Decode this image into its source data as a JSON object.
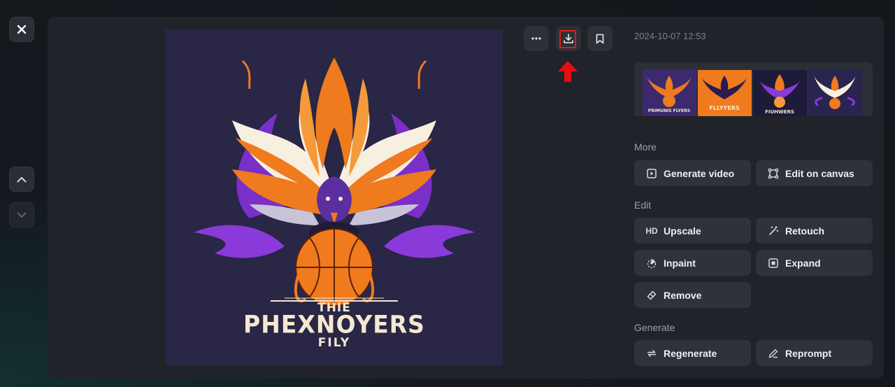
{
  "window": {
    "close_icon": "close-icon",
    "nav_up_icon": "chevron-up-icon",
    "nav_down_icon": "chevron-down-icon"
  },
  "image": {
    "text_line1": "THIE",
    "text_line2": "PHEXNOYERS",
    "text_line3": "FILY",
    "colors": {
      "background": "#292646",
      "flame": "#f07a1e",
      "purple": "#8a3ad8",
      "cream": "#f5e8d0"
    }
  },
  "toolbar": {
    "more_icon": "more-icon",
    "download_icon": "download-icon",
    "bookmark_icon": "bookmark-icon",
    "highlight_color": "#e01b1b"
  },
  "details": {
    "timestamp": "2024-10-07 12:53",
    "thumbnails": [
      {
        "caption": "PRIMUNIS FLYERS",
        "bg": "#3d2a6e"
      },
      {
        "caption": "FLLYYERS",
        "bg": "#f07a1e"
      },
      {
        "caption": "FIUHWERS",
        "bg": "#1e1a3a"
      },
      {
        "caption": "",
        "bg": "#2a2450"
      }
    ]
  },
  "sections": {
    "more": {
      "label": "More",
      "buttons": [
        {
          "label": "Generate video",
          "icon": "video-icon"
        },
        {
          "label": "Edit on canvas",
          "icon": "canvas-icon"
        }
      ]
    },
    "edit": {
      "label": "Edit",
      "buttons": [
        {
          "label": "Upscale",
          "icon": "HD"
        },
        {
          "label": "Retouch",
          "icon": "magic-wand-icon"
        },
        {
          "label": "Inpaint",
          "icon": "inpaint-icon"
        },
        {
          "label": "Expand",
          "icon": "expand-icon"
        },
        {
          "label": "Remove",
          "icon": "eraser-icon"
        }
      ]
    },
    "generate": {
      "label": "Generate",
      "buttons": [
        {
          "label": "Regenerate",
          "icon": "regenerate-icon"
        },
        {
          "label": "Reprompt",
          "icon": "pencil-icon"
        }
      ]
    }
  }
}
